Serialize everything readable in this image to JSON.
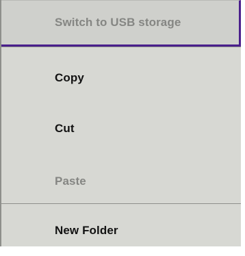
{
  "menu": {
    "switch_storage": {
      "label": "Switch to USB storage",
      "enabled": false
    },
    "copy": {
      "label": "Copy",
      "enabled": true
    },
    "cut": {
      "label": "Cut",
      "enabled": true
    },
    "paste": {
      "label": "Paste",
      "enabled": false
    },
    "new_folder": {
      "label": "New Folder",
      "enabled": true
    }
  },
  "colors": {
    "menu_background": "#d7d8d3",
    "header_background": "#cfd0cc",
    "focus_border": "#4a1f8c",
    "text": "#121212",
    "text_disabled": "#858683"
  }
}
